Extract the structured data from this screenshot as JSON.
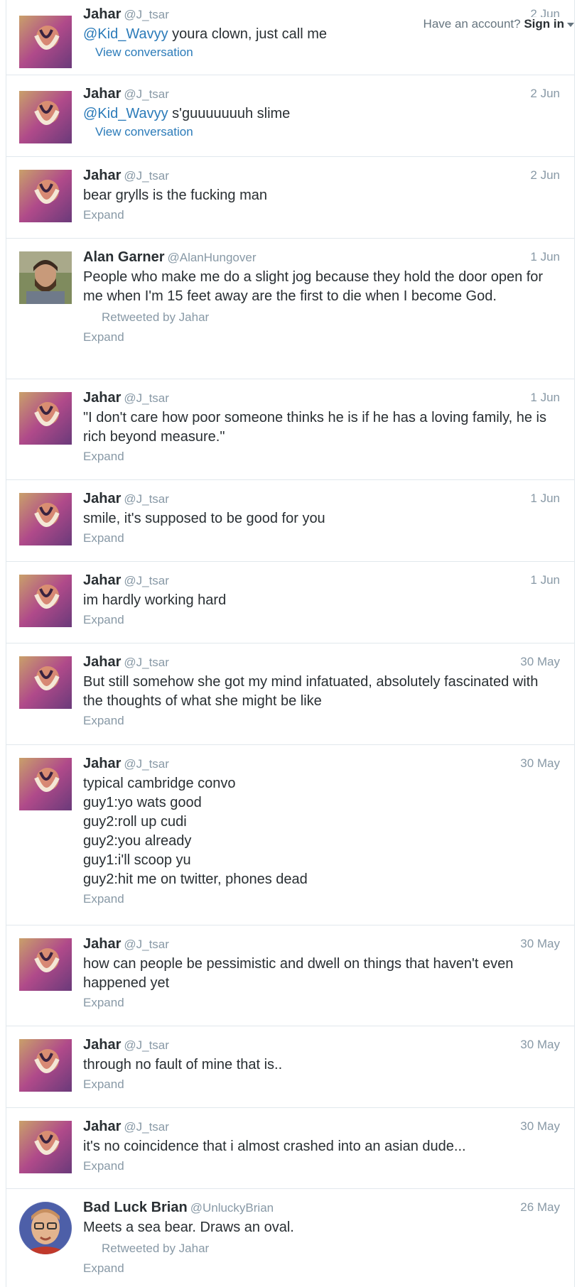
{
  "topbar": {
    "prompt": "Have an account?",
    "signin": "Sign in"
  },
  "tweets": [
    {
      "name": "Jahar",
      "handle": "@J_tsar",
      "time": "2 Jun",
      "mention": "@Kid_Wavyy",
      "text": " youra clown, just call me",
      "action": "View conversation"
    },
    {
      "name": "Jahar",
      "handle": "@J_tsar",
      "time": "2 Jun",
      "mention": "@Kid_Wavyy",
      "text": " s'guuuuuuuh slime",
      "action": "View conversation"
    },
    {
      "name": "Jahar",
      "handle": "@J_tsar",
      "time": "2 Jun",
      "text": "bear grylls is the fucking man",
      "action": "Expand"
    },
    {
      "name": "Alan Garner",
      "handle": "@AlanHungover",
      "time": "1 Jun",
      "text": "People who make me do a slight jog because they hold the door open for me when I'm 15 feet away are the first to die when I become God.",
      "retweet": "Retweeted by Jahar",
      "action": "Expand"
    },
    {
      "name": "Jahar",
      "handle": "@J_tsar",
      "time": "1 Jun",
      "text": "\"I don't care how poor someone thinks he is if he has a loving family, he is rich beyond measure.\"",
      "action": "Expand"
    },
    {
      "name": "Jahar",
      "handle": "@J_tsar",
      "time": "1 Jun",
      "text": "smile, it's supposed to be good for you",
      "action": "Expand"
    },
    {
      "name": "Jahar",
      "handle": "@J_tsar",
      "time": "1 Jun",
      "text": "im hardly working hard",
      "action": "Expand"
    },
    {
      "name": "Jahar",
      "handle": "@J_tsar",
      "time": "30 May",
      "text": "But still somehow she got my mind infatuated, absolutely fascinated with the thoughts of what she might be like",
      "action": "Expand"
    },
    {
      "name": "Jahar",
      "handle": "@J_tsar",
      "time": "30 May",
      "lines": [
        "typical cambridge convo",
        "guy1:yo wats good",
        "guy2:roll up cudi",
        "guy2:you already",
        "guy1:i'll scoop yu",
        "guy2:hit me on twitter, phones dead"
      ],
      "action": "Expand"
    },
    {
      "name": "Jahar",
      "handle": "@J_tsar",
      "time": "30 May",
      "text": "how can people be pessimistic and dwell on things that haven't even happened yet",
      "action": "Expand"
    },
    {
      "name": "Jahar",
      "handle": "@J_tsar",
      "time": "30 May",
      "text": "through no fault of mine that is..",
      "action": "Expand"
    },
    {
      "name": "Jahar",
      "handle": "@J_tsar",
      "time": "30 May",
      "text": "it's no coincidence that i almost crashed into an asian dude...",
      "action": "Expand"
    },
    {
      "name": "Bad Luck Brian",
      "handle": "@UnluckyBrian",
      "time": "26 May",
      "text": "Meets a sea bear. Draws an oval.",
      "retweet": "Retweeted by Jahar",
      "action": "Expand"
    }
  ]
}
